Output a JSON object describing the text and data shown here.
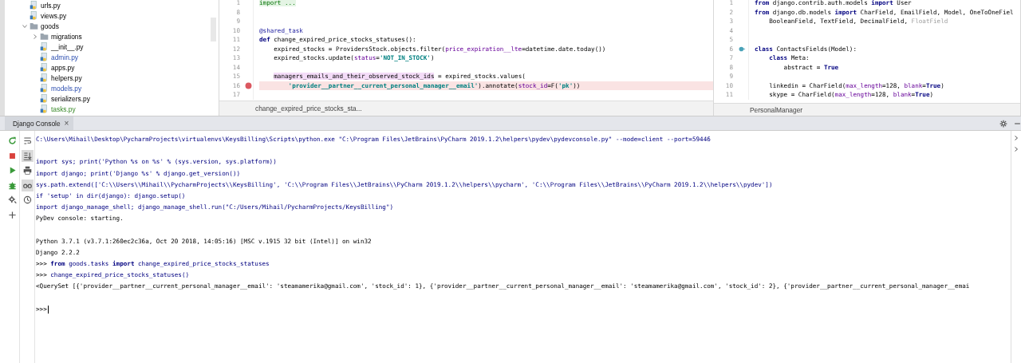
{
  "project_tree": {
    "items": [
      {
        "name": "urls.py",
        "kind": "file",
        "modified": false,
        "added": false
      },
      {
        "name": "views.py",
        "kind": "file",
        "modified": false,
        "added": false
      },
      {
        "name": "goods",
        "kind": "folder",
        "expanded": true,
        "children": [
          {
            "name": "migrations",
            "kind": "folder",
            "expanded": false
          },
          {
            "name": "__init__.py",
            "kind": "file",
            "modified": false,
            "added": false
          },
          {
            "name": "admin.py",
            "kind": "file",
            "modified": true,
            "added": false
          },
          {
            "name": "apps.py",
            "kind": "file",
            "modified": false,
            "added": false
          },
          {
            "name": "helpers.py",
            "kind": "file",
            "modified": false,
            "added": false
          },
          {
            "name": "models.py",
            "kind": "file",
            "modified": true,
            "added": false
          },
          {
            "name": "serializers.py",
            "kind": "file",
            "modified": false,
            "added": false
          },
          {
            "name": "tasks.py",
            "kind": "file",
            "modified": false,
            "added": true
          }
        ]
      }
    ]
  },
  "editors": [
    {
      "breadcrumb": "change_expired_price_stocks_sta...",
      "lines": [
        {
          "number": "1",
          "breakpoint": false,
          "implemented": false,
          "segments": [
            {
              "kind": "folded",
              "text": "import ..."
            }
          ]
        },
        {
          "number": "8",
          "breakpoint": false,
          "implemented": false
        },
        {
          "number": "9",
          "breakpoint": false,
          "implemented": false
        },
        {
          "number": "10",
          "breakpoint": false,
          "implemented": false,
          "segments": [
            {
              "kind": "decorator",
              "text": "@shared_task"
            }
          ]
        },
        {
          "number": "11",
          "breakpoint": false,
          "implemented": false,
          "segments": [
            {
              "kind": "keyword",
              "text": "def "
            },
            {
              "kind": "plain",
              "text": "change_expired_price_stocks_statuses():"
            }
          ]
        },
        {
          "number": "12",
          "breakpoint": false,
          "implemented": false,
          "segments": [
            {
              "kind": "plain",
              "text": "    expired_stocks = ProvidersStock.objects.filter("
            },
            {
              "kind": "param",
              "text": "price_expiration__lte"
            },
            {
              "kind": "plain",
              "text": "=datetime.date.today())"
            }
          ]
        },
        {
          "number": "13",
          "breakpoint": false,
          "implemented": false,
          "segments": [
            {
              "kind": "plain",
              "text": "    expired_stocks.update("
            },
            {
              "kind": "param",
              "text": "status"
            },
            {
              "kind": "plain",
              "text": "="
            },
            {
              "kind": "string",
              "text": "'NOT_IN_STOCK'"
            },
            {
              "kind": "plain",
              "text": ")"
            }
          ]
        },
        {
          "number": "14",
          "breakpoint": false,
          "implemented": false
        },
        {
          "number": "15",
          "breakpoint": false,
          "implemented": false,
          "segments": [
            {
              "kind": "highlight",
              "text": "    managers_emails_and_their_observed_stock_ids"
            },
            {
              "kind": "plain",
              "text": " = expired_stocks.values("
            }
          ]
        },
        {
          "number": "16",
          "breakpoint": true,
          "implemented": false,
          "segments": [
            {
              "kind": "string",
              "text": "        'provider__partner__current_personal_manager__email'"
            },
            {
              "kind": "plain",
              "text": ").annotate("
            },
            {
              "kind": "param",
              "text": "stock_id"
            },
            {
              "kind": "plain",
              "text": "=F("
            },
            {
              "kind": "string",
              "text": "'pk'"
            },
            {
              "kind": "plain",
              "text": "))"
            }
          ]
        },
        {
          "number": "17",
          "breakpoint": false,
          "implemented": false
        }
      ]
    },
    {
      "breadcrumb": "PersonalManager",
      "lines": [
        {
          "number": "1",
          "breakpoint": false,
          "implemented": false,
          "segments": [
            {
              "kind": "keyword",
              "text": "from "
            },
            {
              "kind": "plain",
              "text": "django.contrib.auth.models "
            },
            {
              "kind": "keyword",
              "text": "import "
            },
            {
              "kind": "plain",
              "text": "User"
            }
          ]
        },
        {
          "number": "2",
          "breakpoint": false,
          "implemented": false,
          "segments": [
            {
              "kind": "keyword",
              "text": "from "
            },
            {
              "kind": "plain",
              "text": "django.db.models "
            },
            {
              "kind": "keyword",
              "text": "import "
            },
            {
              "kind": "plain",
              "text": "CharField, EmailField, Model, OneToOneFiel"
            }
          ]
        },
        {
          "number": "3",
          "breakpoint": false,
          "implemented": false,
          "segments": [
            {
              "kind": "plain",
              "text": "    BooleanField, TextField, DecimalField, "
            },
            {
              "kind": "unused",
              "text": "FloatField"
            }
          ]
        },
        {
          "number": "4",
          "breakpoint": false,
          "implemented": false
        },
        {
          "number": "5",
          "breakpoint": false,
          "implemented": false
        },
        {
          "number": "6",
          "breakpoint": false,
          "implemented": true,
          "segments": [
            {
              "kind": "keyword",
              "text": "class "
            },
            {
              "kind": "plain",
              "text": "ContactsFields(Model):"
            }
          ]
        },
        {
          "number": "7",
          "breakpoint": false,
          "implemented": false,
          "segments": [
            {
              "kind": "keyword",
              "text": "    class "
            },
            {
              "kind": "plain",
              "text": "Meta:"
            }
          ]
        },
        {
          "number": "8",
          "breakpoint": false,
          "implemented": false,
          "segments": [
            {
              "kind": "plain",
              "text": "        abstract = "
            },
            {
              "kind": "keyword",
              "text": "True"
            }
          ]
        },
        {
          "number": "9",
          "breakpoint": false,
          "implemented": false
        },
        {
          "number": "10",
          "breakpoint": false,
          "implemented": false,
          "segments": [
            {
              "kind": "plain",
              "text": "    linkedin = CharField("
            },
            {
              "kind": "param",
              "text": "max_length"
            },
            {
              "kind": "plain",
              "text": "=128, "
            },
            {
              "kind": "param",
              "text": "blank"
            },
            {
              "kind": "plain",
              "text": "="
            },
            {
              "kind": "keyword",
              "text": "True"
            },
            {
              "kind": "plain",
              "text": ")"
            }
          ]
        },
        {
          "number": "11",
          "breakpoint": false,
          "implemented": false,
          "segments": [
            {
              "kind": "plain",
              "text": "    skype = CharField("
            },
            {
              "kind": "param",
              "text": "max_length"
            },
            {
              "kind": "plain",
              "text": "=128, "
            },
            {
              "kind": "param",
              "text": "blank"
            },
            {
              "kind": "plain",
              "text": "="
            },
            {
              "kind": "keyword",
              "text": "True"
            },
            {
              "kind": "plain",
              "text": ")"
            }
          ]
        }
      ]
    }
  ],
  "console": {
    "tab": {
      "label": "Django Console",
      "close": "×",
      "selected": true
    },
    "toggles": [
      {
        "kind": "wrap",
        "on": false
      },
      {
        "kind": "scroll",
        "on": true
      },
      {
        "kind": "print",
        "on": false
      },
      {
        "kind": "glasses",
        "on": true
      },
      {
        "kind": "history",
        "on": false
      }
    ],
    "blocks": [
      {
        "lines": [
          [
            {
              "kind": "input",
              "text": "C:\\Users\\Mihail\\Desktop\\PycharmProjects\\virtualenvs\\KeysBilling\\Scripts\\python.exe \"C:\\Program Files\\JetBrains\\PyCharm 2019.1.2\\helpers\\pydev\\pydevconsole.py\" --mode=client --port=59446"
            }
          ]
        ]
      },
      {
        "lines": [
          [
            {
              "kind": "input",
              "text": "import sys; print('Python %s on %s' % (sys.version, sys.platform))"
            }
          ],
          [
            {
              "kind": "input",
              "text": "import django; print('Django %s' % django.get_version())"
            }
          ],
          [
            {
              "kind": "input",
              "text": "sys.path.extend(['C:\\\\Users\\\\Mihail\\\\PycharmProjects\\\\KeysBilling', 'C:\\\\Program Files\\\\JetBrains\\\\PyCharm 2019.1.2\\\\helpers\\\\pycharm', 'C:\\\\Program Files\\\\JetBrains\\\\PyCharm 2019.1.2\\\\helpers\\\\pydev'])"
            }
          ],
          [
            {
              "kind": "input",
              "text": "if 'setup' in dir(django): django.setup()"
            }
          ],
          [
            {
              "kind": "input",
              "text": "import django_manage_shell; django_manage_shell.run(\"C:/Users/Mihail/PycharmProjects/KeysBilling\")"
            }
          ],
          [
            {
              "kind": "output",
              "text": "PyDev console: starting."
            }
          ]
        ]
      },
      {
        "lines": [
          [
            {
              "kind": "output",
              "text": "Python 3.7.1 (v3.7.1:260ec2c36a, Oct 20 2018, 14:05:16) [MSC v.1915 32 bit (Intel)] on win32"
            }
          ],
          [
            {
              "kind": "output",
              "text": "Django 2.2.2"
            }
          ],
          [
            {
              "kind": "prompt",
              "text": ">>> "
            },
            {
              "kind": "keyword",
              "text": "from "
            },
            {
              "kind": "input",
              "text": "goods.tasks "
            },
            {
              "kind": "keyword",
              "text": "import "
            },
            {
              "kind": "input",
              "text": "change_expired_price_stocks_statuses"
            }
          ],
          [
            {
              "kind": "prompt",
              "text": ">>> "
            },
            {
              "kind": "input",
              "text": "change_expired_price_stocks_statuses()"
            }
          ],
          [
            {
              "kind": "output",
              "text": "<QuerySet [{'provider__partner__current_personal_manager__email': 'steamamerika@gmail.com', 'stock_id': 1}, {'provider__partner__current_personal_manager__email': 'steamamerika@gmail.com', 'stock_id': 2}, {'provider__partner__current_personal_manager__emai"
            }
          ]
        ]
      }
    ],
    "prompt": ">>>"
  }
}
